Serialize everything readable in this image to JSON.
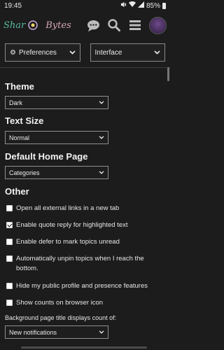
{
  "status": {
    "time": "19:45",
    "battery": "85%"
  },
  "header": {
    "logo_part1": "Shar",
    "logo_part2": "Bytes"
  },
  "nav": {
    "preferences_label": "Preferences",
    "section_label": "Interface"
  },
  "theme": {
    "title": "Theme",
    "value": "Dark"
  },
  "text_size": {
    "title": "Text Size",
    "value": "Normal"
  },
  "home_page": {
    "title": "Default Home Page",
    "value": "Categories"
  },
  "other": {
    "title": "Other",
    "options": [
      {
        "label": "Open all external links in a new tab",
        "checked": false
      },
      {
        "label": "Enable quote reply for highlighted text",
        "checked": true
      },
      {
        "label": "Enable defer to mark topics unread",
        "checked": false
      },
      {
        "label": "Automatically unpin topics when I reach the bottom.",
        "checked": false
      },
      {
        "label": "Hide my public profile and presence features",
        "checked": false
      },
      {
        "label": "Show counts on browser icon",
        "checked": false
      }
    ]
  },
  "title_count": {
    "label": "Background page title displays count of:",
    "value": "New notifications"
  }
}
